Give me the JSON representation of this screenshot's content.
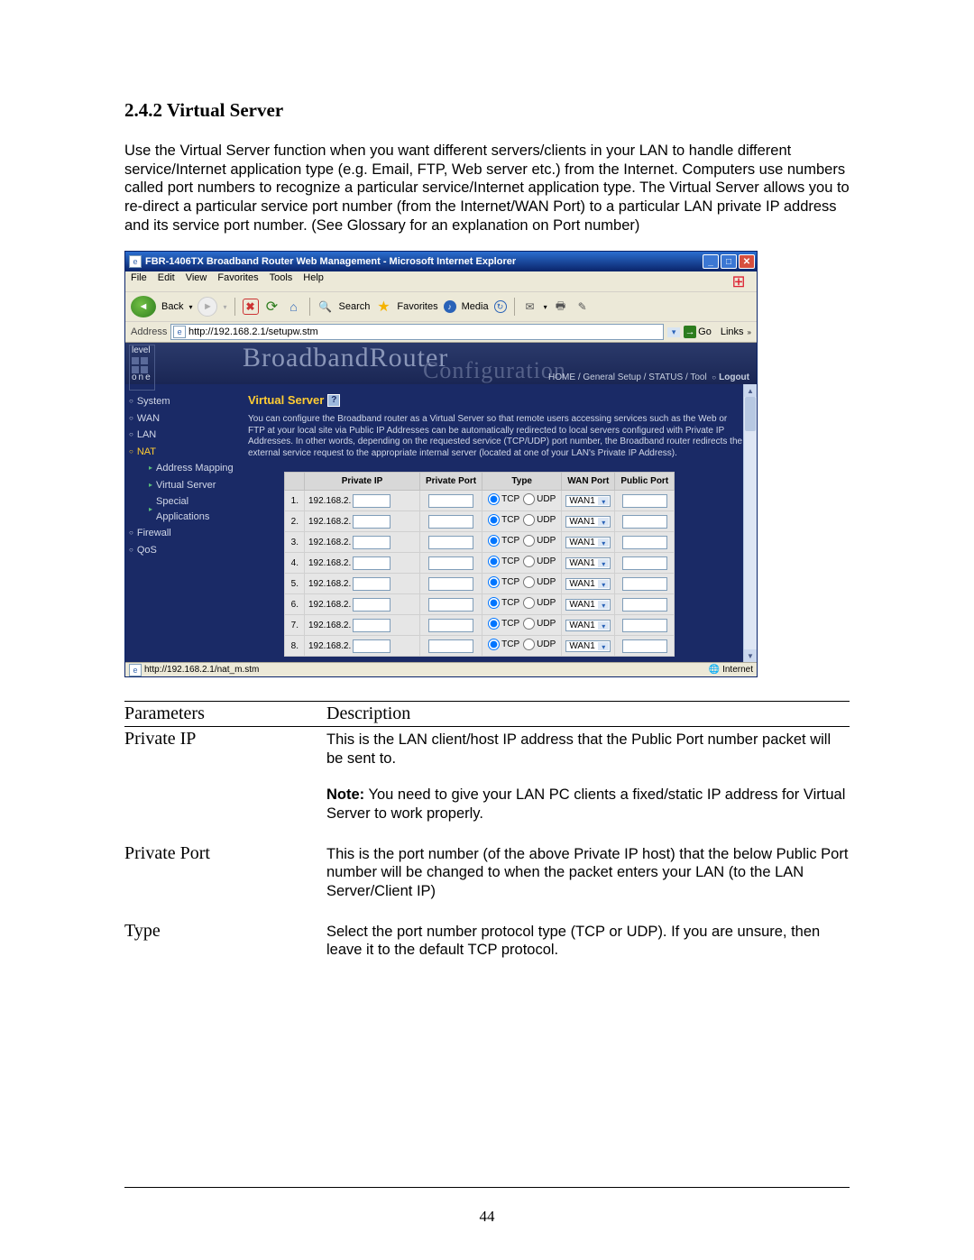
{
  "doc": {
    "section_number": "2.4.2",
    "section_title": "Virtual Server",
    "intro": "Use the Virtual Server function when you want different servers/clients in your LAN to handle different service/Internet application type (e.g. Email, FTP, Web server etc.) from the Internet. Computers use numbers called port numbers to recognize a particular service/Internet application type. The Virtual Server allows you to re-direct a particular service port number (from the Internet/WAN Port) to a particular LAN private IP address and its service port number. (See Glossary for an explanation on Port number)",
    "page_number": "44"
  },
  "ie": {
    "title": "FBR-1406TX Broadband Router Web Management - Microsoft Internet Explorer",
    "menu": [
      "File",
      "Edit",
      "View",
      "Favorites",
      "Tools",
      "Help"
    ],
    "toolbar": {
      "back": "Back",
      "search": "Search",
      "favorites": "Favorites",
      "media": "Media"
    },
    "address_label": "Address",
    "address_value": "http://192.168.2.1/setupw.stm",
    "go_label": "Go",
    "links_label": "Links",
    "status_url": "http://192.168.2.1/nat_m.stm",
    "zone": "Internet"
  },
  "router": {
    "brand_top": "level",
    "brand_bottom": "one",
    "header_title": "BroadbandRouter",
    "header_sub": "Configuration",
    "crumb": {
      "home": "HOME",
      "general": "General Setup",
      "status": "STATUS",
      "tool": "Tool",
      "logout": "Logout"
    },
    "sidebar": {
      "system": "System",
      "wan": "WAN",
      "lan": "LAN",
      "nat": "NAT",
      "addr_mapping": "Address Mapping",
      "virtual_server": "Virtual Server",
      "special_apps": "Special Applications",
      "firewall": "Firewall",
      "qos": "QoS"
    },
    "content": {
      "heading": "Virtual Server",
      "description": "You can configure the Broadband router as a Virtual Server so that remote users accessing services such as the Web or FTP at your local site via Public IP Addresses can be automatically redirected to local servers configured with Private IP Addresses. In other words, depending on the requested service (TCP/UDP) port number, the Broadband router redirects the external service request to the appropriate internal server (located at one of your LAN's Private IP Address).",
      "columns": {
        "priv_ip": "Private IP",
        "priv_port": "Private Port",
        "type": "Type",
        "wan_port": "WAN Port",
        "pub_port": "Public Port"
      },
      "ip_prefix": "192.168.2.",
      "type_tcp": "TCP",
      "type_udp": "UDP",
      "wan_option": "WAN1",
      "rows": [
        1,
        2,
        3,
        4,
        5,
        6,
        7,
        8
      ]
    }
  },
  "params": {
    "headers": {
      "left": "Parameters",
      "right": "Description"
    },
    "items": [
      {
        "name": "Private IP",
        "desc": "This is the LAN client/host IP address that the Public Port number packet will be sent to.",
        "note_label": "Note:",
        "note": " You need to give your LAN PC clients a fixed/static IP address for Virtual Server to work properly."
      },
      {
        "name": "Private Port",
        "desc": "This is the port number (of the above Private IP host) that the below Public Port number will be changed to when the packet enters your LAN (to the LAN Server/Client IP)"
      },
      {
        "name": "Type",
        "desc": "Select the port number protocol type (TCP or UDP). If you are unsure, then leave it to the default TCP protocol."
      }
    ]
  }
}
